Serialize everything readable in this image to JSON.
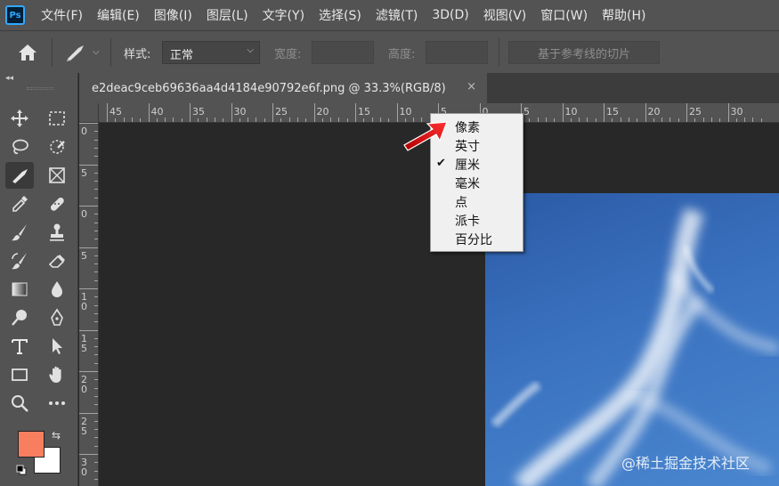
{
  "app": {
    "logo": "Ps"
  },
  "menubar": {
    "items": [
      "文件(F)",
      "编辑(E)",
      "图像(I)",
      "图层(L)",
      "文字(Y)",
      "选择(S)",
      "滤镜(T)",
      "3D(D)",
      "视图(V)",
      "窗口(W)",
      "帮助(H)"
    ]
  },
  "options": {
    "style_label": "样式:",
    "style_value": "正常",
    "width_label": "宽度:",
    "height_label": "高度:",
    "slice_button": "基于参考线的切片"
  },
  "document": {
    "tab_title": "e2deac9ceb69636aa4d4184e90792e6f.png @ 33.3%(RGB/8)",
    "close": "×"
  },
  "ruler": {
    "h_labels": [
      "45",
      "40",
      "35",
      "30",
      "25",
      "20",
      "15",
      "10",
      "5",
      "0",
      "5",
      "10",
      "15",
      "20",
      "25",
      "30"
    ],
    "v_labels": [
      "0",
      "5",
      "0",
      "5",
      "1 0",
      "1 5",
      "2 0",
      "2 5",
      "3 0"
    ]
  },
  "units_menu": {
    "items": [
      {
        "label": "像素",
        "checked": false
      },
      {
        "label": "英寸",
        "checked": false
      },
      {
        "label": "厘米",
        "checked": true
      },
      {
        "label": "毫米",
        "checked": false
      },
      {
        "label": "点",
        "checked": false
      },
      {
        "label": "派卡",
        "checked": false
      },
      {
        "label": "百分比",
        "checked": false
      }
    ],
    "check_mark": "✔"
  },
  "colors": {
    "foreground": "#f77f5f",
    "background": "#ffffff",
    "accent_arrow": "#e02020"
  },
  "watermark": "@稀土掘金技术社区"
}
